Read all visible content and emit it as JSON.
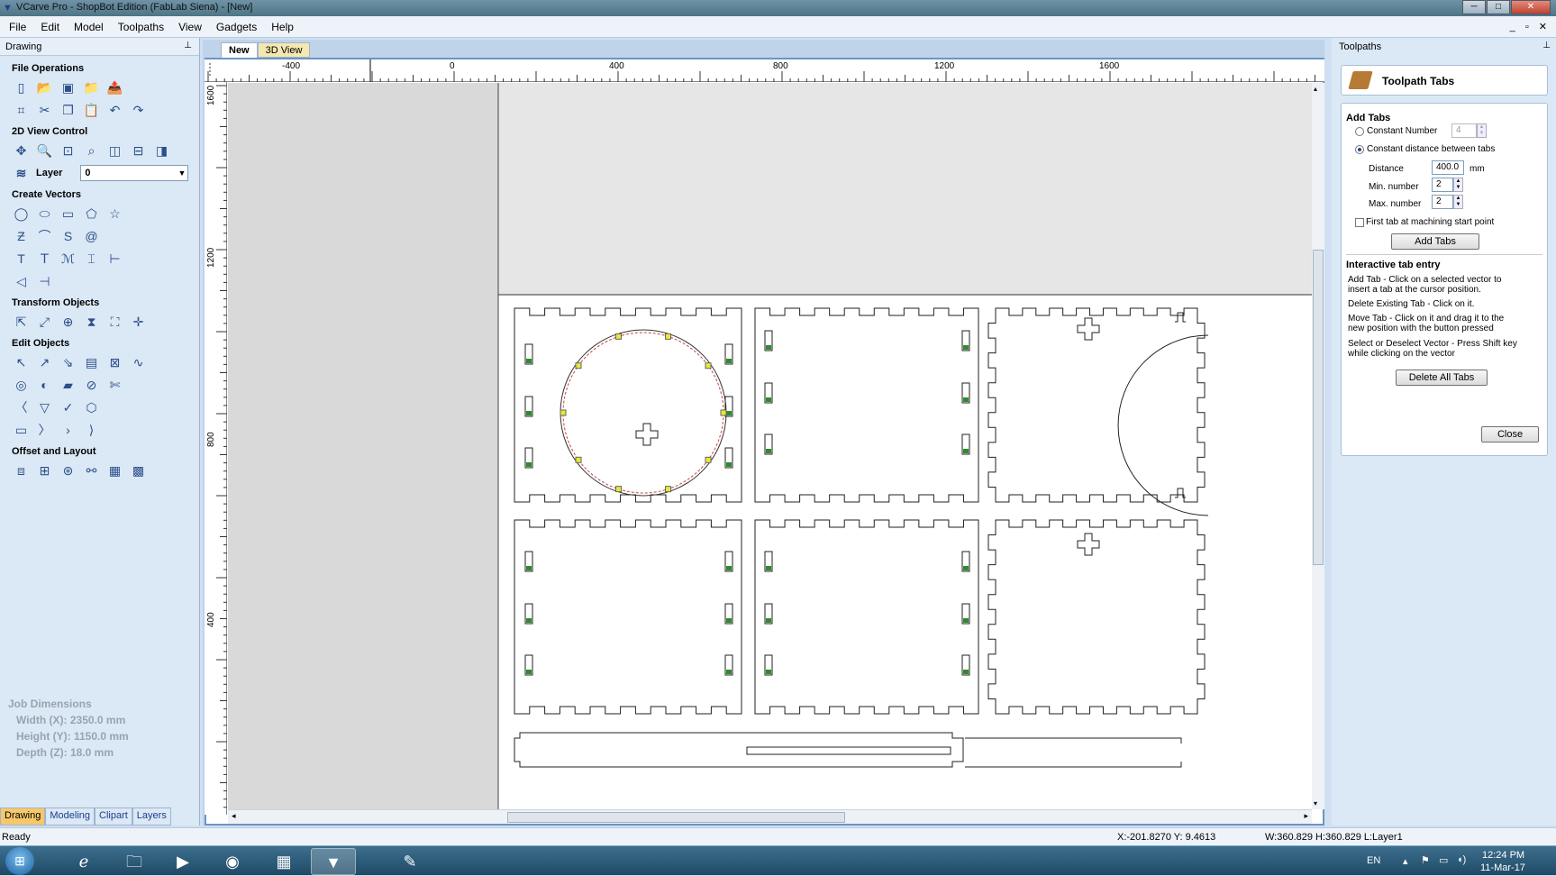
{
  "window": {
    "title": "VCarve Pro - ShopBot Edition (FabLab Siena) - [New]",
    "min": "─",
    "max": "□",
    "close": "✕"
  },
  "menu": [
    "File",
    "Edit",
    "Model",
    "Toolpaths",
    "View",
    "Gadgets",
    "Help"
  ],
  "left_panel": {
    "title": "Drawing",
    "pin": "⊥",
    "file_operations": "File Operations",
    "view_control": "2D View Control",
    "layer_label": "Layer",
    "layer_value": "0",
    "create_vectors": "Create Vectors",
    "transform_objects": "Transform Objects",
    "edit_objects": "Edit Objects",
    "offset_layout": "Offset and Layout"
  },
  "job_dimensions": {
    "title": "Job Dimensions",
    "width": "Width  (X): 2350.0 mm",
    "height": "Height (Y): 1150.0 mm",
    "depth": "Depth  (Z): 18.0 mm"
  },
  "bottom_tabs": [
    "Drawing",
    "Modeling",
    "Clipart",
    "Layers"
  ],
  "doc_tabs": [
    "New",
    "3D View"
  ],
  "ruler": {
    "top": [
      "-400",
      "0",
      "400",
      "800",
      "1200",
      "1600"
    ],
    "left": [
      "1600",
      "1200",
      "800",
      "400"
    ]
  },
  "right_panel": {
    "title": "Toolpaths",
    "pin": "⊥",
    "header": "Toolpath Tabs",
    "add_tabs_title": "Add Tabs",
    "constant_number": "Constant Number",
    "constant_number_value": "4",
    "constant_distance": "Constant distance between tabs",
    "distance_label": "Distance",
    "distance_value": "400.0",
    "distance_unit": "mm",
    "min_label": "Min. number",
    "min_value": "2",
    "max_label": "Max. number",
    "max_value": "2",
    "first_tab": "First tab at machining start point",
    "add_tabs_btn": "Add Tabs",
    "interactive_title": "Interactive tab entry",
    "help1": "Add Tab - Click on a selected vector to",
    "help1b": "insert a tab at the cursor position.",
    "help2": "Delete Existing Tab - Click on it.",
    "help3": "Move Tab - Click on it and drag it to the",
    "help3b": "new position with the button pressed",
    "help4": "Select or Deselect Vector - Press Shift key",
    "help4b": "while clicking on the vector",
    "delete_all_btn": "Delete All Tabs",
    "close_btn": "Close"
  },
  "status": {
    "ready": "Ready",
    "coords": "X:-201.8270 Y: 9.4613",
    "size": "W:360.829   H:360.829  L:Layer1"
  },
  "tray": {
    "lang": "EN",
    "time": "12:24 PM",
    "date": "11-Mar-17"
  }
}
